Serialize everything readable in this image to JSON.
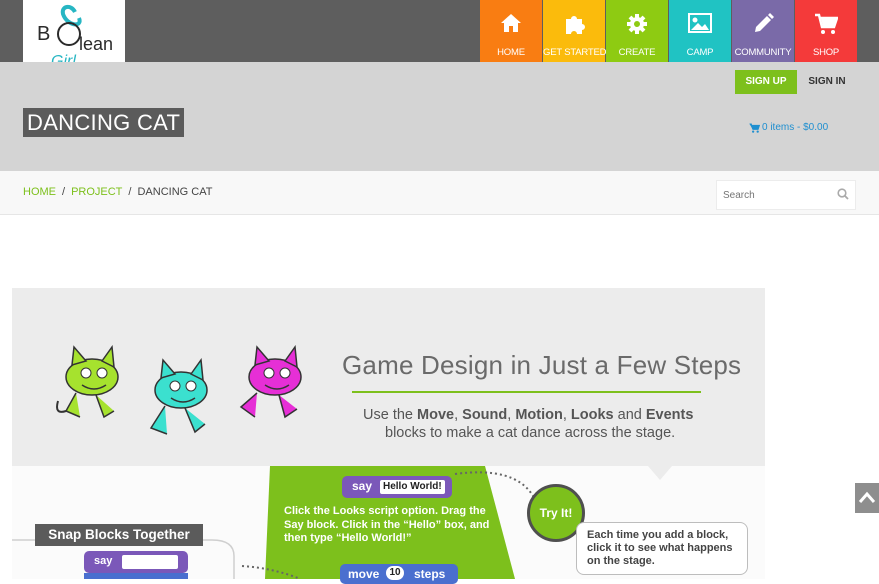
{
  "header": {
    "logo_text": "BOolean Girl",
    "nav": [
      {
        "label": "HOME",
        "icon": "home-icon",
        "color": "#f97d12"
      },
      {
        "label": "GET STARTED",
        "icon": "puzzle-icon",
        "color": "#fbbb0c"
      },
      {
        "label": "CREATE",
        "icon": "gear-icon",
        "color": "#8ecb12"
      },
      {
        "label": "CAMP",
        "icon": "image-icon",
        "color": "#20c3c3"
      },
      {
        "label": "COMMUNITY",
        "icon": "pencil-icon",
        "color": "#7a6aa8"
      },
      {
        "label": "SHOP",
        "icon": "cart-icon",
        "color": "#f43a3a"
      }
    ]
  },
  "account": {
    "signup_label": "SIGN UP",
    "signin_label": "SIGN IN"
  },
  "page": {
    "title": "DANCING CAT"
  },
  "cart": {
    "summary": "0 items - $0.00"
  },
  "breadcrumb": {
    "home": "HOME",
    "project": "PROJECT",
    "current": "DANCING CAT",
    "separator": "/"
  },
  "search": {
    "placeholder": "Search"
  },
  "banner": {
    "title": "Game Design in Just a Few Steps",
    "subtitle_prefix": "Use the",
    "kw1": "Move",
    "kw2": "Sound",
    "kw3": "Motion",
    "kw4": "Looks",
    "kw5": "Events",
    "and": "and",
    "subtitle_line2": "blocks to make a cat dance across the stage.",
    "cat_colors": [
      "#a6e22e",
      "#3be0cf",
      "#e62fd6"
    ]
  },
  "steps": {
    "say_word": "say",
    "say_value": "Hello World!",
    "instruction": "Click the Looks script option. Drag the Say block. Click in the “Hello” box, and then type “Hello World!”",
    "try_it": "Try It!",
    "tip": "Each time you add a block, click it to see what happens on the stage.",
    "move_word": "move",
    "move_value": "10",
    "steps_word": "steps",
    "snap_title": "Snap Blocks Together",
    "snap_say": "say"
  },
  "colors": {
    "accent_green": "#7dc01c",
    "link_blue": "#1f8fd0",
    "header_gray": "#5e5e5e"
  }
}
